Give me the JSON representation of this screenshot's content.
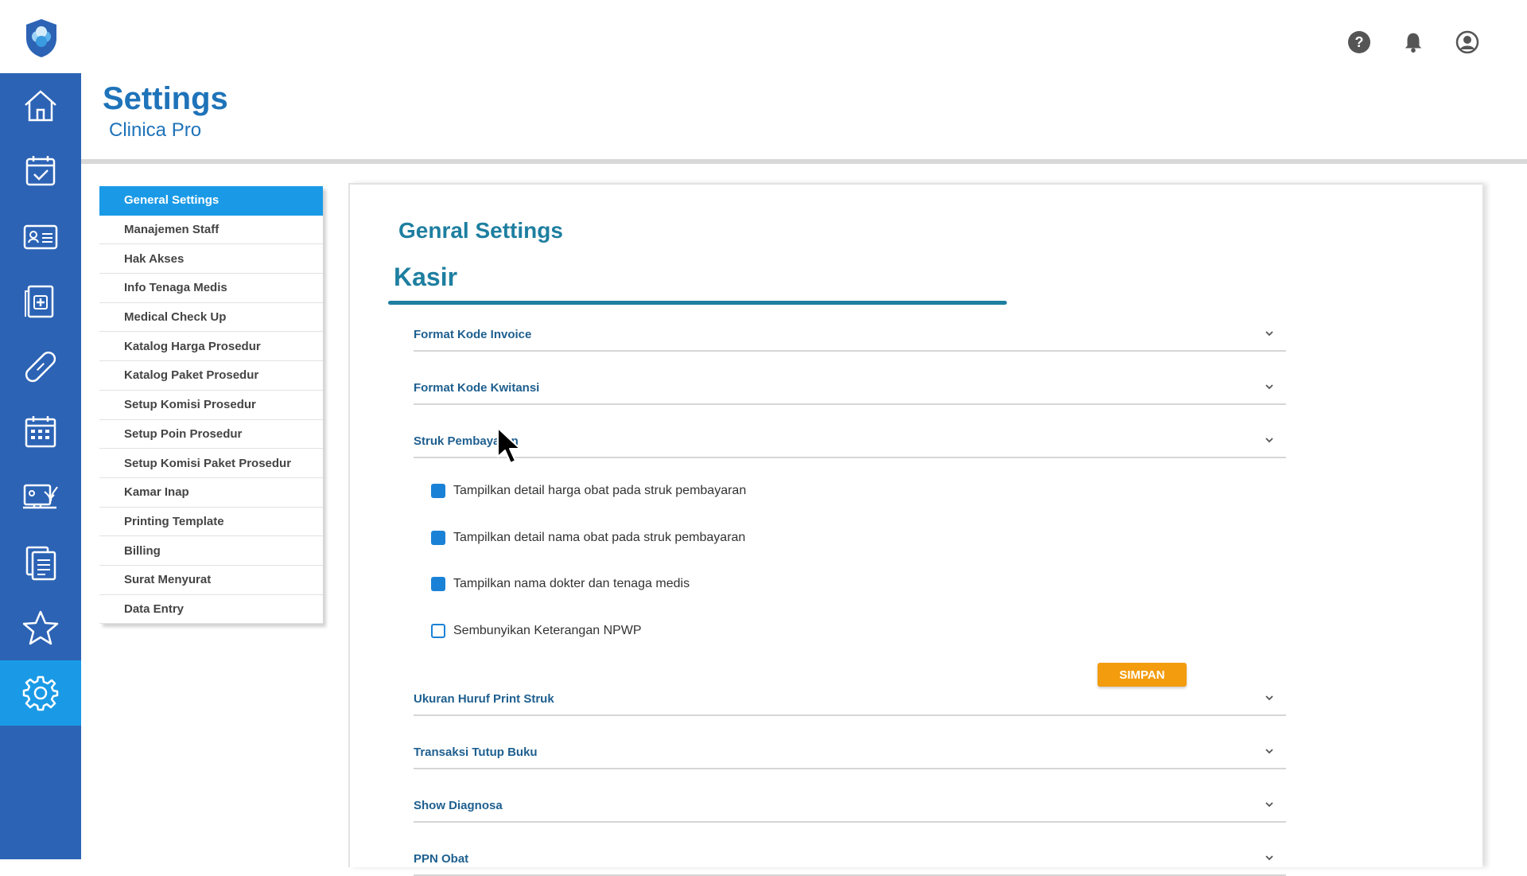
{
  "topbar": {
    "icons": [
      "help-icon",
      "bell-icon",
      "user-account-icon"
    ]
  },
  "sidebar": {
    "icons": [
      "home-icon",
      "calendar-check-icon",
      "id-card-icon",
      "medical-record-icon",
      "bandage-icon",
      "schedule-grid-icon",
      "monitor-plant-icon",
      "clipboard-list-icon",
      "star-icon",
      "gear-icon"
    ],
    "active_index": 9,
    "active_color": "#1a9ae6",
    "background": "#2c63b5"
  },
  "header": {
    "title": "Settings",
    "subtitle": "Clinica Pro"
  },
  "settings_menu": {
    "items": [
      "General Settings",
      "Manajemen Staff",
      "Hak Akses",
      "Info Tenaga Medis",
      "Medical Check Up",
      "Katalog Harga Prosedur",
      "Katalog Paket Prosedur",
      "Setup Komisi Prosedur",
      "Setup Poin Prosedur",
      "Setup Komisi Paket Prosedur",
      "Kamar Inap",
      "Printing Template",
      "Billing",
      "Surat Menyurat",
      "Data Entry"
    ],
    "active": "General Settings"
  },
  "panel": {
    "title": "Genral Settings",
    "section": "Kasir",
    "accordions": [
      "Format Kode Invoice",
      "Format Kode Kwitansi",
      "Struk Pembayaran",
      "Ukuran Huruf Print Struk",
      "Transaksi Tutup Buku",
      "Show Diagnosa",
      "PPN Obat"
    ],
    "struk_options": [
      {
        "label": "Tampilkan detail harga obat pada struk pembayaran",
        "checked": true
      },
      {
        "label": "Tampilkan detail nama obat pada struk pembayaran",
        "checked": true
      },
      {
        "label": "Tampilkan nama dokter dan tenaga medis",
        "checked": true
      },
      {
        "label": "Sembunyikan Keterangan NPWP",
        "checked": false
      }
    ],
    "save_label": "SIMPAN"
  },
  "colors": {
    "accent": "#1e7fa0",
    "save": "#f39c0e"
  }
}
